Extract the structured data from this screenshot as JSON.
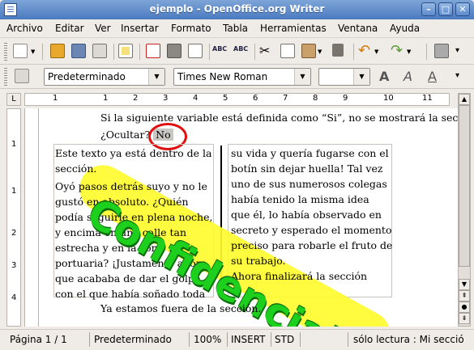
{
  "window": {
    "title": "ejemplo - OpenOffice.org Writer"
  },
  "menu": [
    "Archivo",
    "Editar",
    "Ver",
    "Insertar",
    "Formato",
    "Tabla",
    "Herramientas",
    "Ventana",
    "Ayuda"
  ],
  "format_toolbar": {
    "style": "Predeterminado",
    "font": "Times New Roman",
    "size": ""
  },
  "ruler": {
    "h_labels": [
      "1",
      "1",
      "2",
      "3",
      "4",
      "5",
      "6",
      "7",
      "8",
      "9",
      "10",
      "11"
    ],
    "v_labels": [
      "1",
      "1",
      "2",
      "3",
      "4"
    ]
  },
  "document": {
    "line1": "Si la siguiente variable está definida como “Si”, no se mostrará la sec",
    "ocultar_label": "¿Ocultar?",
    "ocultar_value": "No",
    "col1": [
      "Este texto ya está dentro de la",
      "sección.",
      "Oyó pasos detrás suyo y no le",
      "gustó en absoluto. ¿Quién",
      "podía seguirle en plena noche,",
      "y encima en una calle tan",
      "estrecha y en la zona",
      "portuaria? ¡Justamente ahora",
      "que acababa de dar el golpe",
      "con el que había soñado toda"
    ],
    "col2": [
      "su vida y quería fugarse con el",
      "botín sin dejar huella! Tal vez",
      "uno de sus numerosos colegas",
      "había tenido la misma idea",
      "que él, lo había observado en",
      "secreto y esperado el momento",
      "preciso para robarle el fruto de",
      "su trabajo.",
      "Ahora finalizará la sección"
    ],
    "after_section": "Ya estamos fuera de la sección.",
    "watermark": "Confidencial"
  },
  "status": {
    "page": "Página  1 / 1",
    "style": "Predeterminado",
    "zoom": "100%",
    "mode": "INSERT",
    "selection": "STD",
    "readonly": "sólo lectura : Mi secció"
  }
}
